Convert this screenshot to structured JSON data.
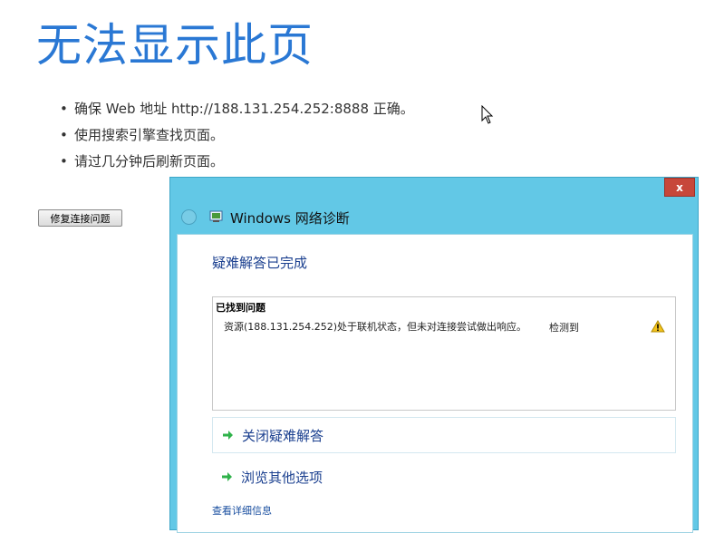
{
  "page": {
    "title": "无法显示此页",
    "tips": [
      "确保 Web 地址 http://188.131.254.252:8888 正确。",
      "使用搜索引擎查找页面。",
      "请过几分钟后刷新页面。"
    ],
    "fix_button_label": "修复连接问题"
  },
  "dialog": {
    "title": "Windows 网络诊断",
    "close_label": "x",
    "heading": "疑难解答已完成",
    "problems_header": "已找到问题",
    "problem": {
      "description": "资源(188.131.254.252)处于联机状态，但未对连接尝试做出响应。",
      "status": "检测到",
      "icon": "warning-icon"
    },
    "options": [
      {
        "label": "关闭疑难解答",
        "icon": "green-arrow-icon"
      },
      {
        "label": "浏览其他选项",
        "icon": "green-arrow-icon"
      }
    ],
    "details_link": "查看详细信息"
  },
  "colors": {
    "title_blue": "#2a78d4",
    "dialog_frame": "#62c8e6",
    "close_red": "#c7473a",
    "link_blue": "#1a3f8f",
    "arrow_green": "#2fb24a"
  }
}
